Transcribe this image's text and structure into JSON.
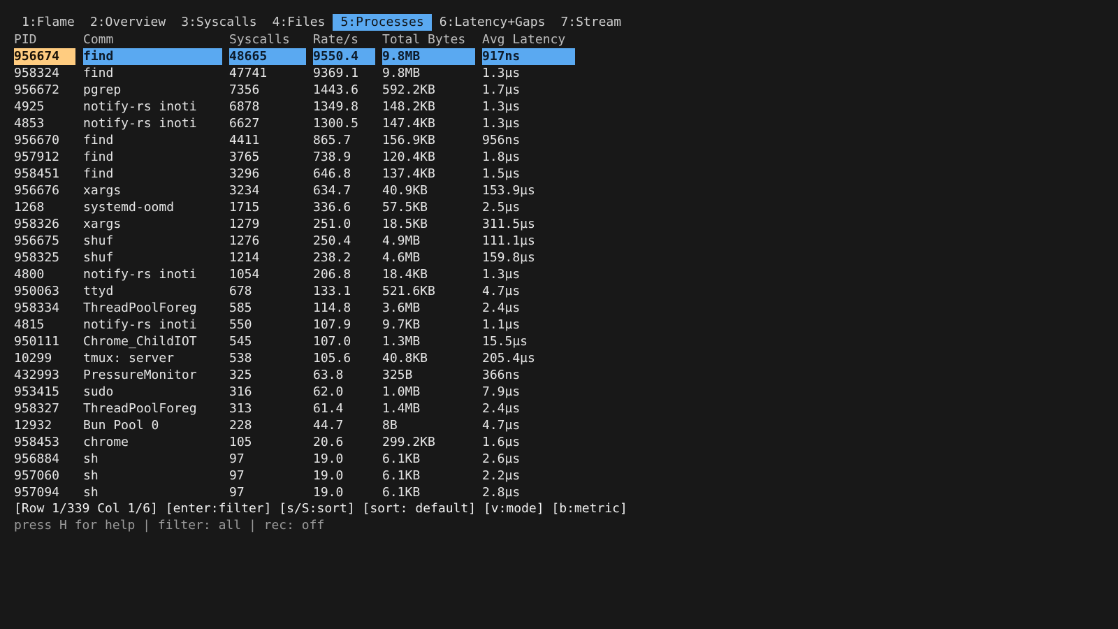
{
  "tabs": [
    {
      "label": "1:Flame",
      "active": false
    },
    {
      "label": "2:Overview",
      "active": false
    },
    {
      "label": "3:Syscalls",
      "active": false
    },
    {
      "label": "4:Files",
      "active": false
    },
    {
      "label": "5:Processes",
      "active": true
    },
    {
      "label": "6:Latency+Gaps",
      "active": false
    },
    {
      "label": "7:Stream",
      "active": false
    }
  ],
  "table": {
    "columns": [
      "PID",
      "Comm",
      "Syscalls",
      "Rate/s",
      "Total Bytes",
      "Avg Latency"
    ],
    "selected_row": 0,
    "rows": [
      [
        "956674",
        "find",
        "48665",
        "9550.4",
        "9.8MB",
        "917ns"
      ],
      [
        "958324",
        "find",
        "47741",
        "9369.1",
        "9.8MB",
        "1.3µs"
      ],
      [
        "956672",
        "pgrep",
        "7356",
        "1443.6",
        "592.2KB",
        "1.7µs"
      ],
      [
        "4925",
        "notify-rs inoti",
        "6878",
        "1349.8",
        "148.2KB",
        "1.3µs"
      ],
      [
        "4853",
        "notify-rs inoti",
        "6627",
        "1300.5",
        "147.4KB",
        "1.3µs"
      ],
      [
        "956670",
        "find",
        "4411",
        "865.7",
        "156.9KB",
        "956ns"
      ],
      [
        "957912",
        "find",
        "3765",
        "738.9",
        "120.4KB",
        "1.8µs"
      ],
      [
        "958451",
        "find",
        "3296",
        "646.8",
        "137.4KB",
        "1.5µs"
      ],
      [
        "956676",
        "xargs",
        "3234",
        "634.7",
        "40.9KB",
        "153.9µs"
      ],
      [
        "1268",
        "systemd-oomd",
        "1715",
        "336.6",
        "57.5KB",
        "2.5µs"
      ],
      [
        "958326",
        "xargs",
        "1279",
        "251.0",
        "18.5KB",
        "311.5µs"
      ],
      [
        "956675",
        "shuf",
        "1276",
        "250.4",
        "4.9MB",
        "111.1µs"
      ],
      [
        "958325",
        "shuf",
        "1214",
        "238.2",
        "4.6MB",
        "159.8µs"
      ],
      [
        "4800",
        "notify-rs inoti",
        "1054",
        "206.8",
        "18.4KB",
        "1.3µs"
      ],
      [
        "950063",
        "ttyd",
        "678",
        "133.1",
        "521.6KB",
        "4.7µs"
      ],
      [
        "958334",
        "ThreadPoolForeg",
        "585",
        "114.8",
        "3.6MB",
        "2.4µs"
      ],
      [
        "4815",
        "notify-rs inoti",
        "550",
        "107.9",
        "9.7KB",
        "1.1µs"
      ],
      [
        "950111",
        "Chrome_ChildIOT",
        "545",
        "107.0",
        "1.3MB",
        "15.5µs"
      ],
      [
        "10299",
        "tmux: server",
        "538",
        "105.6",
        "40.8KB",
        "205.4µs"
      ],
      [
        "432993",
        "PressureMonitor",
        "325",
        "63.8",
        "325B",
        "366ns"
      ],
      [
        "953415",
        "sudo",
        "316",
        "62.0",
        "1.0MB",
        "7.9µs"
      ],
      [
        "958327",
        "ThreadPoolForeg",
        "313",
        "61.4",
        "1.4MB",
        "2.4µs"
      ],
      [
        "12932",
        "Bun Pool 0",
        "228",
        "44.7",
        "8B",
        "4.7µs"
      ],
      [
        "958453",
        "chrome",
        "105",
        "20.6",
        "299.2KB",
        "1.6µs"
      ],
      [
        "956884",
        "sh",
        "97",
        "19.0",
        "6.1KB",
        "2.6µs"
      ],
      [
        "957060",
        "sh",
        "97",
        "19.0",
        "6.1KB",
        "2.2µs"
      ],
      [
        "957094",
        "sh",
        "97",
        "19.0",
        "6.1KB",
        "2.8µs"
      ]
    ]
  },
  "status_line": "[Row 1/339 Col 1/6] [enter:filter] [s/S:sort] [sort: default] [v:mode] [b:metric]",
  "hint_line": "press H for help | filter: all | rec: off",
  "colors": {
    "background": "#181818",
    "accent": "#5aa9f1",
    "selected_pid": "#ffcc80",
    "text": "#e6e6e6",
    "muted": "#9a9a9a"
  }
}
